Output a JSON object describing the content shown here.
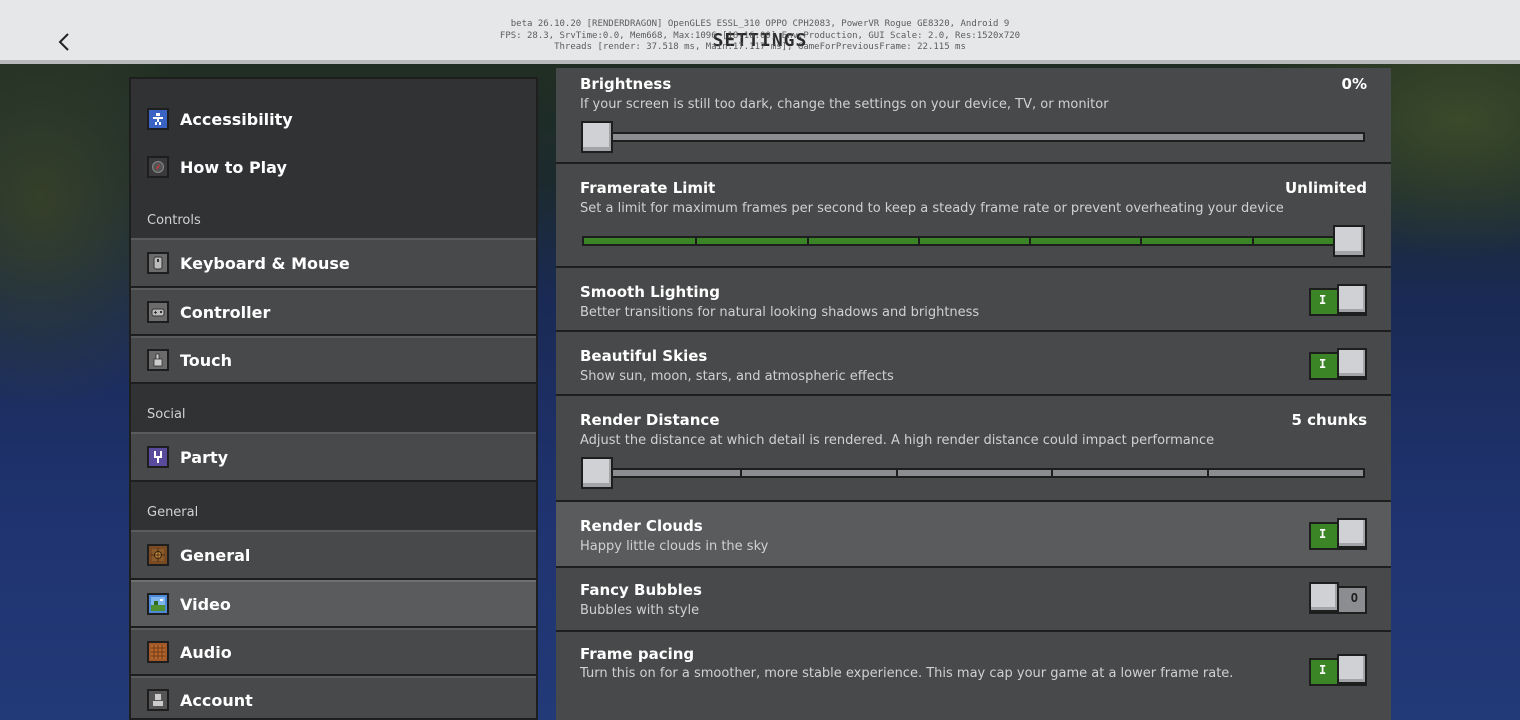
{
  "header": {
    "title": "SETTINGS",
    "debug_lines": [
      "beta 26.10.20 [RENDERDRAGON] OpenGLES ESSL_310 OPPO CPH2083, PowerVR Rogue GE8320, Android 9",
      "FPS: 28.3, SrvTime:0.0, Mem668, Max:1096 [18:16:00] Env:Production, GUI Scale: 2.0, Res:1520x720",
      "Threads [render: 37.518 ms, Main:17.117 ms], GameForPreviousFrame: 22.115 ms"
    ]
  },
  "sidebar": {
    "items_top": [
      {
        "label": "Accessibility",
        "icon": "accessibility-icon"
      },
      {
        "label": "How to Play",
        "icon": "compass-icon"
      }
    ],
    "sections": [
      {
        "label": "Controls",
        "items": [
          {
            "label": "Keyboard & Mouse",
            "icon": "mouse-icon"
          },
          {
            "label": "Controller",
            "icon": "gamepad-icon"
          },
          {
            "label": "Touch",
            "icon": "hand-icon"
          }
        ]
      },
      {
        "label": "Social",
        "items": [
          {
            "label": "Party",
            "icon": "party-icon"
          }
        ]
      },
      {
        "label": "General",
        "items": [
          {
            "label": "General",
            "icon": "gear-block-icon"
          },
          {
            "label": "Video",
            "icon": "landscape-icon",
            "selected": true
          },
          {
            "label": "Audio",
            "icon": "note-block-icon"
          },
          {
            "label": "Account",
            "icon": "account-icon"
          }
        ]
      }
    ]
  },
  "settings": [
    {
      "id": "brightness",
      "title": "Brightness",
      "desc": "If your screen is still too dark, change the settings on your device, TV, or monitor",
      "value": "0%",
      "kind": "slider",
      "level": 0.0,
      "steps": 0
    },
    {
      "id": "framerate",
      "title": "Framerate Limit",
      "desc": "Set a limit for maximum frames per second to keep a steady frame rate or prevent overheating your device",
      "value": "Unlimited",
      "kind": "slider",
      "level": 1.0,
      "steps": 7
    },
    {
      "id": "smooth-lighting",
      "title": "Smooth Lighting",
      "desc": "Better transitions for natural looking shadows and brightness",
      "kind": "toggle",
      "on": true
    },
    {
      "id": "beautiful-skies",
      "title": "Beautiful Skies",
      "desc": "Show sun, moon, stars, and atmospheric effects",
      "kind": "toggle",
      "on": true
    },
    {
      "id": "render-distance",
      "title": "Render Distance",
      "desc": "Adjust the distance at which detail is rendered. A high render distance could impact performance",
      "value": "5 chunks",
      "kind": "slider",
      "level": 0.0,
      "steps": 5
    },
    {
      "id": "render-clouds",
      "title": "Render Clouds",
      "desc": "Happy little clouds in the sky",
      "kind": "toggle",
      "on": true
    },
    {
      "id": "fancy-bubbles",
      "title": "Fancy Bubbles",
      "desc": "Bubbles with style",
      "kind": "toggle",
      "on": false
    },
    {
      "id": "frame-pacing",
      "title": "Frame pacing",
      "desc": "Turn this on for a smoother, more stable experience. This may cap your game at a lower frame rate.",
      "kind": "toggle",
      "on": true
    }
  ],
  "toggle_marks": {
    "on": "I",
    "off": "O"
  },
  "colors": {
    "accent_green": "#3c8527",
    "panel": "#48494a",
    "sidebar": "#313233",
    "selected": "#5a5b5c"
  }
}
